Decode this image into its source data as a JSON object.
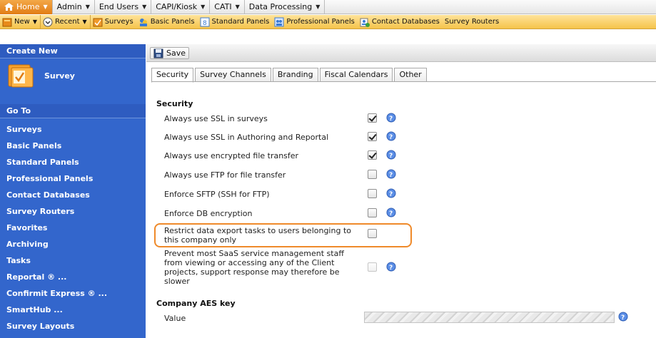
{
  "menu": {
    "items": [
      {
        "label": "Home",
        "active": true
      },
      {
        "label": "Admin",
        "active": false
      },
      {
        "label": "End Users",
        "active": false
      },
      {
        "label": "CAPI/Kiosk",
        "active": false
      },
      {
        "label": "CATI",
        "active": false
      },
      {
        "label": "Data Processing",
        "active": false
      }
    ]
  },
  "toolbar": {
    "new_label": "New",
    "recent_label": "Recent",
    "surveys_label": "Surveys",
    "basic_panels_label": "Basic Panels",
    "standard_panels_label": "Standard Panels",
    "professional_panels_label": "Professional Panels",
    "contact_databases_label": "Contact Databases",
    "survey_routers_label": "Survey Routers"
  },
  "sidebar": {
    "create_new_header": "Create New",
    "survey_tile_label": "Survey",
    "goto_header": "Go To",
    "items": [
      "Surveys",
      "Basic Panels",
      "Standard Panels",
      "Professional Panels",
      "Contact Databases",
      "Survey Routers",
      "Favorites",
      "Archiving",
      "Tasks",
      "Reportal ® ...",
      "Confirmit Express ® ...",
      "SmartHub ...",
      "Survey Layouts"
    ]
  },
  "savebar": {
    "save_label": "Save"
  },
  "tabs": [
    {
      "label": "Security",
      "active": true
    },
    {
      "label": "Survey Channels",
      "active": false
    },
    {
      "label": "Branding",
      "active": false
    },
    {
      "label": "Fiscal Calendars",
      "active": false
    },
    {
      "label": "Other",
      "active": false
    }
  ],
  "security": {
    "title": "Security",
    "settings": [
      {
        "label": "Always use SSL in surveys",
        "checked": true,
        "enabled": true
      },
      {
        "label": "Always use SSL in Authoring and Reportal",
        "checked": true,
        "enabled": true
      },
      {
        "label": "Always use encrypted file transfer",
        "checked": true,
        "enabled": true
      },
      {
        "label": "Always use FTP for file transfer",
        "checked": false,
        "enabled": true
      },
      {
        "label": "Enforce SFTP (SSH for FTP)",
        "checked": false,
        "enabled": true
      },
      {
        "label": "Enforce DB encryption",
        "checked": false,
        "enabled": true
      },
      {
        "label": "Restrict data export tasks to users belonging to this company only",
        "checked": false,
        "enabled": true
      },
      {
        "label": "Prevent most SaaS service management staff from viewing or accessing any of the Client projects, support response may therefore be slower",
        "checked": false,
        "enabled": false
      }
    ]
  },
  "aes": {
    "title": "Company AES key",
    "value_label": "Value"
  },
  "colors": {
    "sidebar_bg": "#3366cc",
    "menu_active": "#e27c14",
    "toolbar_bg": "#f5c44b",
    "highlight_outline": "#ef8a2a"
  },
  "icons": [
    "home-icon",
    "caret-down-icon",
    "new-icon",
    "recent-icon",
    "surveys-icon",
    "basic-panels-icon",
    "standard-panels-icon",
    "professional-panels-icon",
    "contact-databases-icon",
    "disk-icon",
    "help-icon",
    "survey-folder-icon"
  ]
}
